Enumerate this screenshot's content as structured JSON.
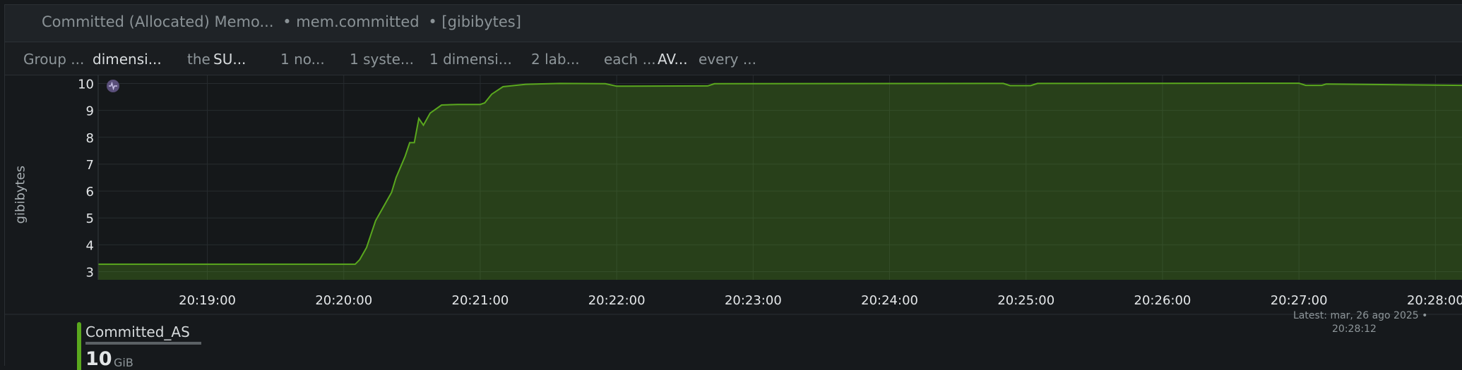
{
  "title": {
    "name": "Committed (Allocated) Memo...",
    "context": "• mem.committed",
    "units": "• [gibibytes]"
  },
  "toolbar": {
    "group_label": "Group ...",
    "group_value": "dimensi...",
    "the_label": "the",
    "the_value": "SU...",
    "nodes": "1 no...",
    "systems": "1 syste...",
    "dimensions": "1 dimensi...",
    "labels": "2 lab...",
    "each_label": "each ...",
    "each_value": "AV...",
    "every_label": "every ..."
  },
  "legend": {
    "name": "Committed_AS",
    "value": "10",
    "unit": "GiB",
    "color": "#5aa81e"
  },
  "latest": {
    "label": "Latest:",
    "date": "mar, 26 ago 2025 •",
    "time": "20:28:12"
  },
  "chart_data": {
    "type": "area",
    "ylabel": "gibibytes",
    "ylim": [
      2.7,
      10.3
    ],
    "yticks": [
      3,
      4,
      5,
      6,
      7,
      8,
      9,
      10
    ],
    "xlim": [
      "20:18:12",
      "20:28:12"
    ],
    "xticks": [
      "20:19:00",
      "20:20:00",
      "20:21:00",
      "20:22:00",
      "20:23:00",
      "20:24:00",
      "20:25:00",
      "20:26:00",
      "20:27:00",
      "20:28:00"
    ],
    "color": "#5aa81e",
    "grid": true,
    "series": [
      {
        "x": [
          "20:18:12",
          "20:20:05",
          "20:20:07",
          "20:20:10",
          "20:20:14",
          "20:20:18",
          "20:20:21",
          "20:20:23",
          "20:20:25",
          "20:20:27",
          "20:20:29",
          "20:20:31",
          "20:20:33",
          "20:20:35",
          "20:20:38",
          "20:20:43",
          "20:20:50",
          "20:21:00",
          "20:21:02",
          "20:21:05",
          "20:21:10",
          "20:21:20",
          "20:21:35",
          "20:21:55",
          "20:22:00",
          "20:22:40",
          "20:22:43",
          "20:24:50",
          "20:24:53",
          "20:25:02",
          "20:25:05",
          "20:27:00",
          "20:27:03",
          "20:27:10",
          "20:27:12",
          "20:28:12"
        ],
        "y": [
          3.28,
          3.28,
          3.45,
          3.9,
          4.9,
          5.5,
          5.95,
          6.5,
          6.9,
          7.3,
          7.8,
          7.8,
          8.7,
          8.45,
          8.9,
          9.2,
          9.22,
          9.22,
          9.28,
          9.6,
          9.88,
          9.97,
          10.0,
          9.99,
          9.9,
          9.91,
          9.99,
          10.0,
          9.92,
          9.92,
          10.0,
          10.01,
          9.93,
          9.93,
          9.98,
          9.93
        ]
      }
    ]
  }
}
